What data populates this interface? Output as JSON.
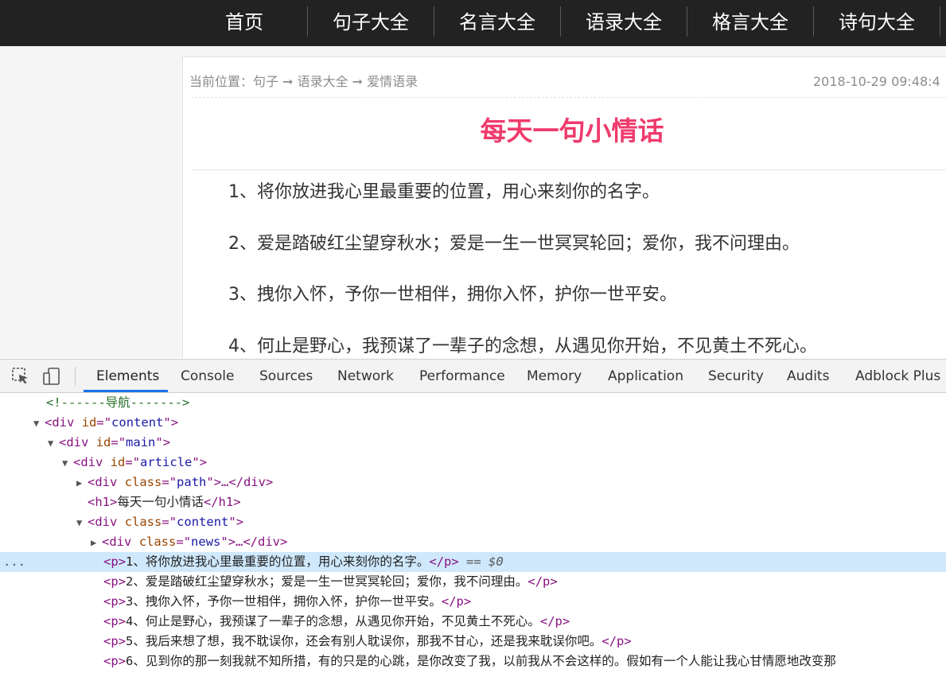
{
  "nav": {
    "items": [
      "首页",
      "句子大全",
      "名言大全",
      "语录大全",
      "格言大全",
      "诗句大全"
    ]
  },
  "article": {
    "path_text": "当前位置：句子 ➞ 语录大全 ➞ 爱情语录",
    "date": "2018-10-29 09:48:4",
    "title": "每天一句小情话",
    "title_color": "#ef3b6c",
    "paragraphs": [
      "1、将你放进我心里最重要的位置，用心来刻你的名字。",
      "2、爱是踏破红尘望穿秋水；爱是一生一世冥冥轮回；爱你，我不问理由。",
      "3、拽你入怀，予你一世相伴，拥你入怀，护你一世平安。",
      "4、何止是野心，我预谋了一辈子的念想，从遇见你开始，不见黄土不死心。"
    ]
  },
  "devtools": {
    "inspect_icon": "cursor-select-icon",
    "device_icon": "device-toggle-icon",
    "tabs": [
      "Elements",
      "Console",
      "Sources",
      "Network",
      "Performance",
      "Memory",
      "Application",
      "Security",
      "Audits",
      "Adblock Plus"
    ],
    "active_tab": "Elements",
    "selected_suffix": " == $0",
    "ellipsis": "...",
    "dom": [
      {
        "type": "comment",
        "text": "<!------导航------->"
      },
      {
        "type": "open",
        "tag": "div",
        "attr": "id",
        "val": "content",
        "expand": "▼"
      },
      {
        "type": "open",
        "tag": "div",
        "attr": "id",
        "val": "main",
        "expand": "▼"
      },
      {
        "type": "open",
        "tag": "div",
        "attr": "id",
        "val": "article",
        "expand": "▼"
      },
      {
        "type": "collapsed",
        "tag": "div",
        "attr": "class",
        "val": "path",
        "expand": "▶"
      },
      {
        "type": "text",
        "tag": "h1",
        "text": "每天一句小情话"
      },
      {
        "type": "open",
        "tag": "div",
        "attr": "class",
        "val": "content",
        "expand": "▼"
      },
      {
        "type": "collapsed",
        "tag": "div",
        "attr": "class",
        "val": "news",
        "expand": "▶"
      },
      {
        "type": "text",
        "tag": "p",
        "text": "1、将你放进我心里最重要的位置，用心来刻你的名字。",
        "selected": true
      },
      {
        "type": "text",
        "tag": "p",
        "text": "2、爱是踏破红尘望穿秋水；爱是一生一世冥冥轮回；爱你，我不问理由。"
      },
      {
        "type": "text",
        "tag": "p",
        "text": "3、拽你入怀，予你一世相伴，拥你入怀，护你一世平安。"
      },
      {
        "type": "text",
        "tag": "p",
        "text": "4、何止是野心，我预谋了一辈子的念想，从遇见你开始，不见黄土不死心。"
      },
      {
        "type": "text",
        "tag": "p",
        "text": "5、我后来想了想，我不耽误你，还会有别人耽误你，那我不甘心，还是我来耽误你吧。"
      },
      {
        "type": "text",
        "tag": "p",
        "text": "6、见到你的那一刻我就不知所措，有的只是的心跳，是你改变了我，以前我从不会这样的。假如有一个人能让我心甘情愿地改变那",
        "truncated": true
      }
    ]
  }
}
